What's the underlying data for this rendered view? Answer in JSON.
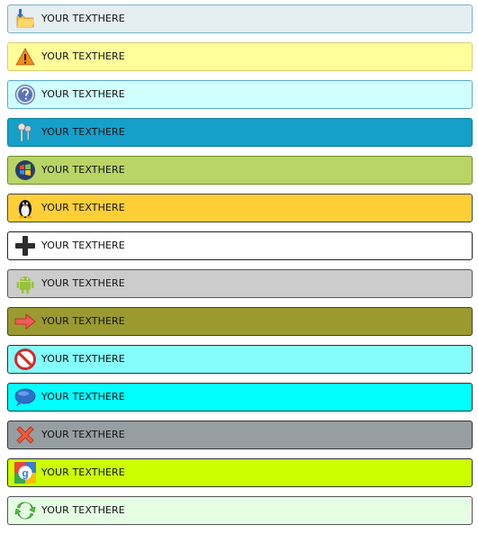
{
  "bars": [
    {
      "label": "YOUR TEXTHERE",
      "icon": "folder-download-icon",
      "bg": "#e5eef0",
      "border": "#7ab3c7"
    },
    {
      "label": "YOUR TEXTHERE",
      "icon": "warning-icon",
      "bg": "#fffe9b",
      "border": "#d8cf6a"
    },
    {
      "label": "YOUR TEXTHERE",
      "icon": "help-icon",
      "bg": "#cfffff",
      "border": "#5aa9d6"
    },
    {
      "label": "YOUR TEXTHERE",
      "icon": "keys-icon",
      "bg": "#14a0c9",
      "border": "#0d7ea0"
    },
    {
      "label": "YOUR TEXTHERE",
      "icon": "windows-icon",
      "bg": "#b8d565",
      "border": "#6e8a2c"
    },
    {
      "label": "YOUR TEXTHERE",
      "icon": "linux-penguin-icon",
      "bg": "#ffcf37",
      "border": "#444444"
    },
    {
      "label": "YOUR TEXTHERE",
      "icon": "plus-icon",
      "bg": "#ffffff",
      "border": "#222222"
    },
    {
      "label": "YOUR TEXTHERE",
      "icon": "android-icon",
      "bg": "#cccccc",
      "border": "#555555"
    },
    {
      "label": "YOUR TEXTHERE",
      "icon": "arrow-right-icon",
      "bg": "#9a9a30",
      "border": "#444422"
    },
    {
      "label": "YOUR TEXTHERE",
      "icon": "no-entry-icon",
      "bg": "#85fdfd",
      "border": "#333333"
    },
    {
      "label": "YOUR TEXTHERE",
      "icon": "chat-bubble-icon",
      "bg": "#00ffff",
      "border": "#333333"
    },
    {
      "label": "YOUR TEXTHERE",
      "icon": "close-x-icon",
      "bg": "#969ea2",
      "border": "#333333"
    },
    {
      "label": "YOUR TEXTHERE",
      "icon": "google-icon",
      "bg": "#ccff00",
      "border": "#333333"
    },
    {
      "label": "YOUR TEXTHERE",
      "icon": "refresh-icon",
      "bg": "#e5fee3",
      "border": "#555555"
    }
  ]
}
